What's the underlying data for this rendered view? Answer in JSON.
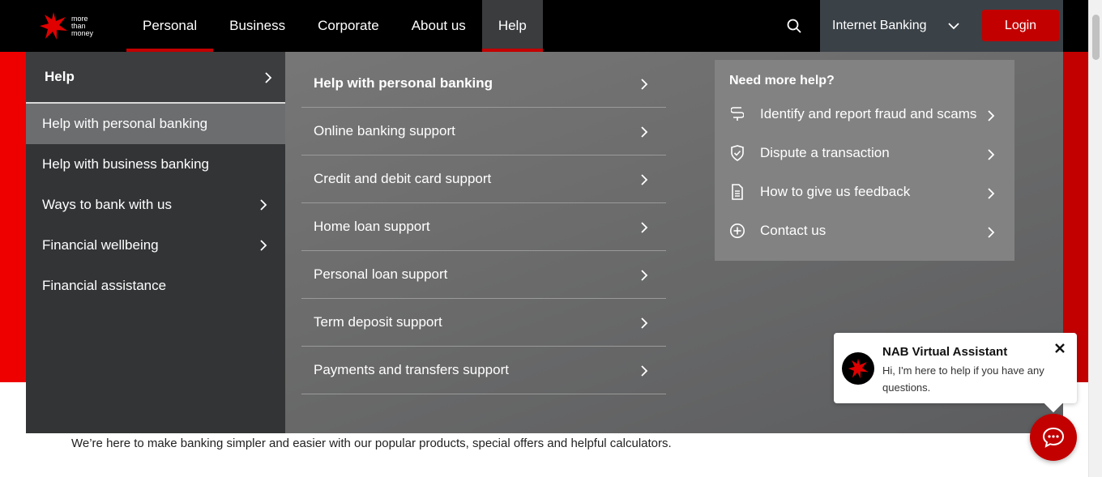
{
  "logo": {
    "tagline_lines": [
      "more",
      "than",
      "money"
    ]
  },
  "nav": {
    "items": [
      {
        "label": "Personal"
      },
      {
        "label": "Business"
      },
      {
        "label": "Corporate"
      },
      {
        "label": "About us"
      },
      {
        "label": "Help"
      }
    ],
    "internet_banking": "Internet Banking",
    "login": "Login"
  },
  "menu": {
    "left": {
      "heading": "Help",
      "items": [
        {
          "label": "Help with personal banking",
          "has_chevron": false,
          "selected": true
        },
        {
          "label": "Help with business banking",
          "has_chevron": false
        },
        {
          "label": "Ways to bank with us",
          "has_chevron": true
        },
        {
          "label": "Financial wellbeing",
          "has_chevron": true
        },
        {
          "label": "Financial assistance",
          "has_chevron": false
        }
      ]
    },
    "middle": {
      "items": [
        {
          "label": "Help with personal banking"
        },
        {
          "label": "Online banking support"
        },
        {
          "label": "Credit and debit card support"
        },
        {
          "label": "Home loan support"
        },
        {
          "label": "Personal loan support"
        },
        {
          "label": "Term deposit support"
        },
        {
          "label": "Payments and transfers support"
        }
      ]
    },
    "help_box": {
      "title": "Need more help?",
      "links": [
        {
          "label": "Identify and report fraud and scams",
          "icon": "fraud-icon"
        },
        {
          "label": "Dispute a transaction",
          "icon": "shield-check-icon"
        },
        {
          "label": "How to give us feedback",
          "icon": "document-icon"
        },
        {
          "label": "Contact us",
          "icon": "plus-circle-icon"
        }
      ]
    }
  },
  "page": {
    "intro_text": "We’re here to make banking simpler and easier with our popular products, special offers and helpful calculators."
  },
  "assistant": {
    "title": "NAB Virtual Assistant",
    "message": "Hi, I'm here to help if you have any questions."
  },
  "colors": {
    "brand_red": "#c20000",
    "header_black": "#000000",
    "menu_dark": "#323436"
  }
}
